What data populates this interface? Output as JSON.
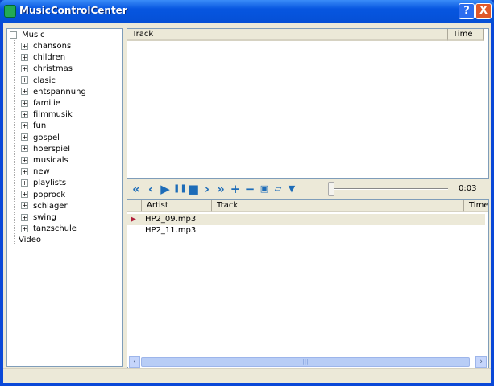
{
  "window": {
    "title": "MusicControlCenter",
    "help": "?",
    "close": "X"
  },
  "tree": {
    "root": "Music",
    "root_expander": "−",
    "child_expander": "+",
    "children": [
      "chansons",
      "children",
      "christmas",
      "clasic",
      "entspannung",
      "familie",
      "filmmusik",
      "fun",
      "gospel",
      "hoerspiel",
      "musicals",
      "new",
      "playlists",
      "poprock",
      "schlager",
      "swing",
      "tanzschule"
    ],
    "other": "Video"
  },
  "top_list": {
    "columns": [
      "Track",
      "Time"
    ]
  },
  "toolbar": {
    "icons": [
      "first-icon",
      "previous-icon",
      "play-icon",
      "pause-icon",
      "stop-icon",
      "next-icon",
      "last-icon",
      "add-icon",
      "remove-icon",
      "save-icon",
      "open-icon",
      "download-icon"
    ],
    "glyphs": [
      "«",
      "‹",
      "▶",
      "❚❚",
      "■",
      "›",
      "»",
      "+",
      "−",
      "▣",
      "▱",
      "▼"
    ],
    "position_fraction": 0.0,
    "time": "0:03"
  },
  "bottom_list": {
    "columns": [
      "Artist",
      "Track",
      "Time"
    ],
    "rows": [
      {
        "artist": "HP2_09.mp3",
        "playing": true
      },
      {
        "artist": "HP2_11.mp3",
        "playing": false
      }
    ]
  },
  "scrollbar": {
    "left": "‹",
    "right": "›",
    "grip": "|||"
  }
}
